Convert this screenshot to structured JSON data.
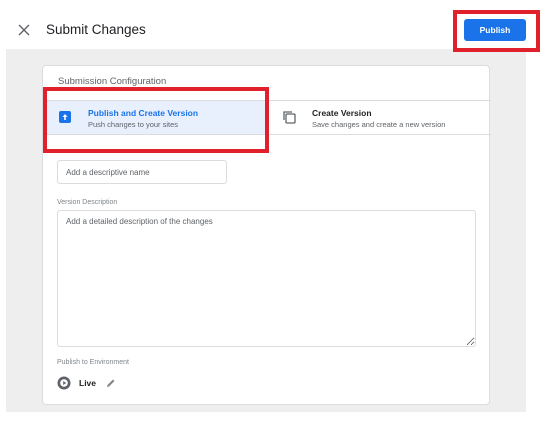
{
  "header": {
    "title": "Submit Changes",
    "publish_label": "Publish"
  },
  "submission": {
    "section_title": "Submission Configuration",
    "options": [
      {
        "title": "Publish and Create Version",
        "subtitle": "Push changes to your sites",
        "icon": "publish-upload-icon",
        "selected": true
      },
      {
        "title": "Create Version",
        "subtitle": "Save changes and create a new version",
        "icon": "copy-version-icon",
        "selected": false
      }
    ],
    "version_name_placeholder": "Add a descriptive name",
    "version_description_label": "Version Description",
    "version_description_placeholder": "Add a detailed description of the changes",
    "environment_label": "Publish to Environment",
    "environment_name": "Live"
  },
  "colors": {
    "accent": "#1a73e8",
    "selected_bg": "#e8f0fe",
    "highlight": "#e0202b"
  }
}
